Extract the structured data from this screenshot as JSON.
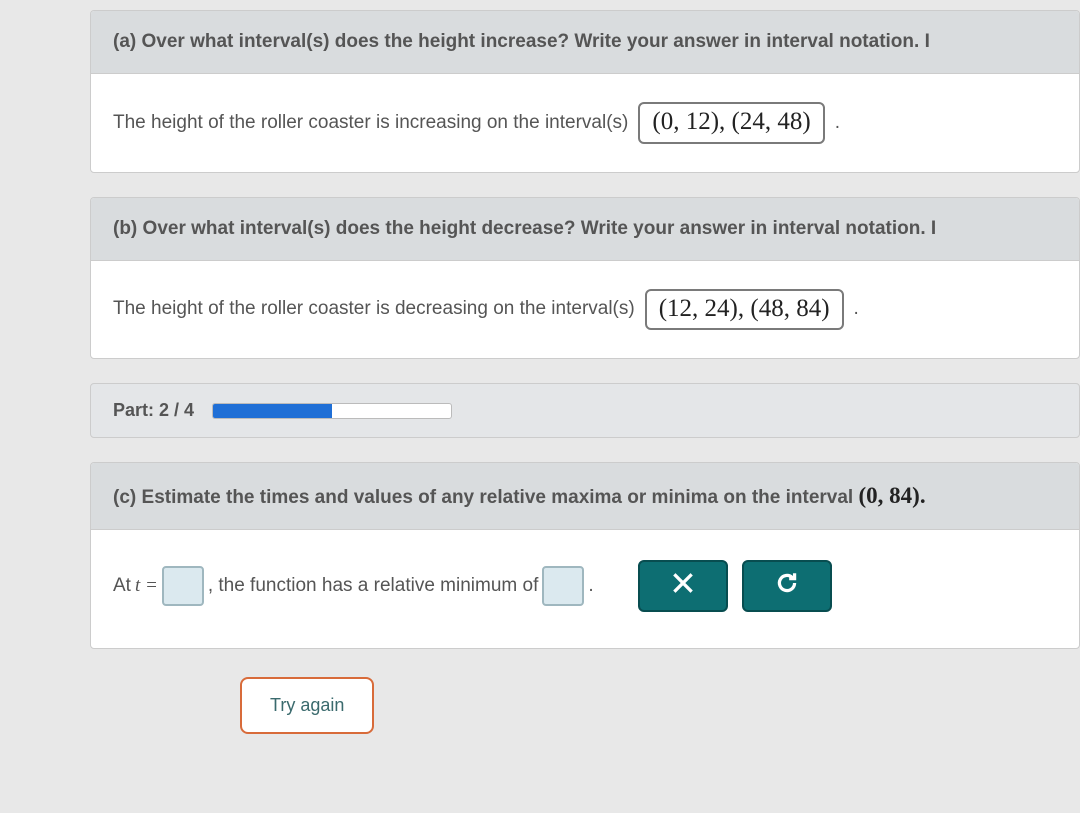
{
  "part_a": {
    "prefix": "(a)",
    "question": "Over what interval(s) does the height increase? Write your answer in interval notation. I",
    "body_text": "The height of the roller coaster is increasing on the interval(s)",
    "answer": "(0, 12), (24, 48)",
    "suffix": "."
  },
  "part_b": {
    "prefix": "(b)",
    "question": "Over what interval(s) does the height decrease? Write your answer in interval notation. I",
    "body_text": "The height of the roller coaster is decreasing on the interval(s)",
    "answer": "(12, 24), (48, 84)",
    "suffix": "."
  },
  "progress": {
    "label": "Part: 2 / 4",
    "percent": 50
  },
  "part_c": {
    "prefix": "(c)",
    "question": "Estimate the times and values of any relative maxima or minima on the interval",
    "interval": "(0, 84).",
    "body_at": "At ",
    "body_t_eq": "t =",
    "body_mid": ", the function has a relative minimum of",
    "body_end": "."
  },
  "buttons": {
    "try_again": "Try again"
  }
}
